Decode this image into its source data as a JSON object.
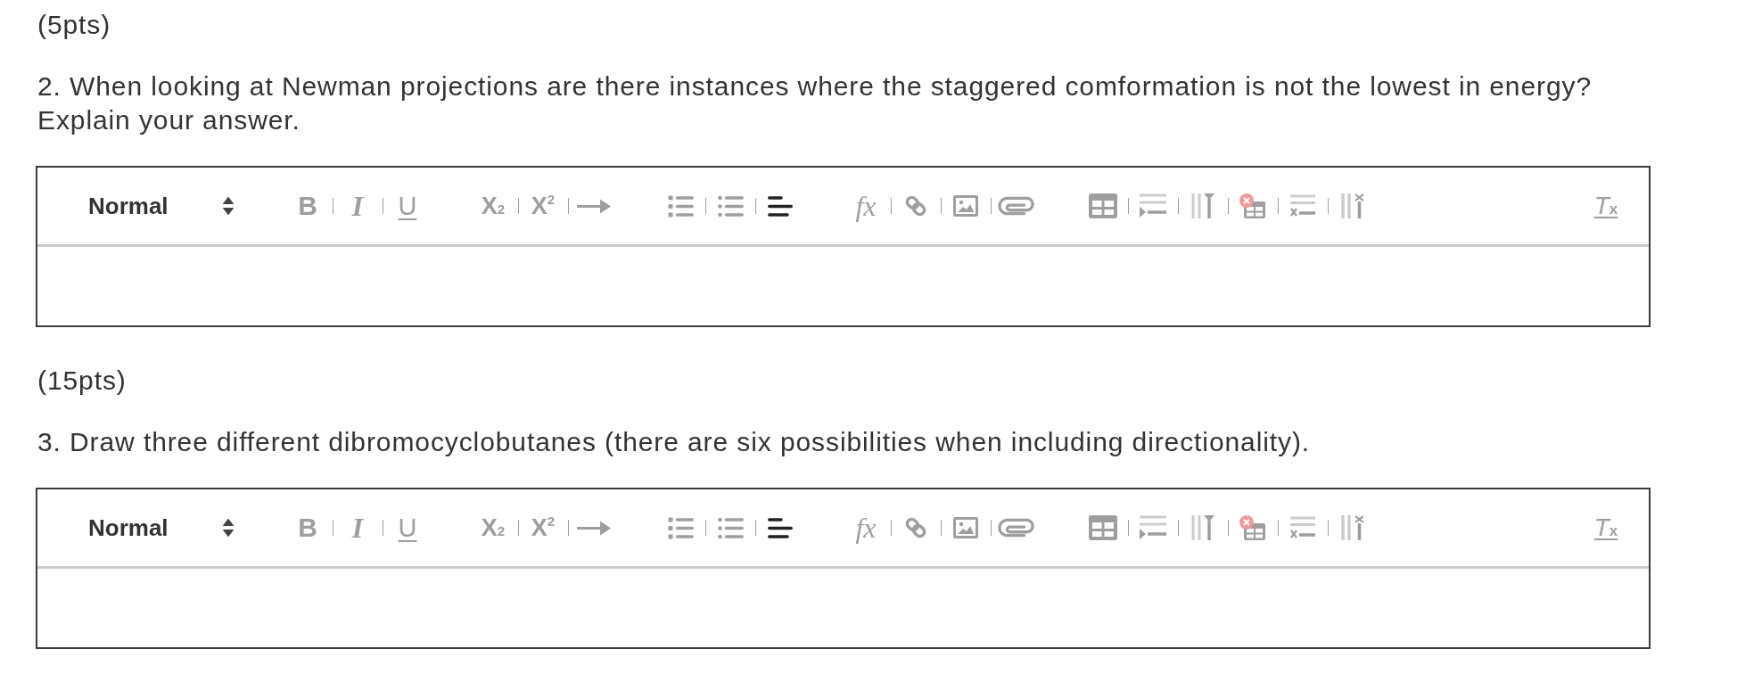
{
  "sections": [
    {
      "points": "(5pts)",
      "question": [
        "2. When looking at Newman projections are there instances where the staggered comformation is not the lowest in energy?",
        "Explain your answer."
      ],
      "editor": {
        "toolbar": {
          "format": "Normal",
          "groups": [
            {
              "buttons": [
                {
                  "kind": "bold",
                  "label": "B",
                  "active": false
                },
                {
                  "kind": "italic",
                  "label": "I",
                  "active": false
                },
                {
                  "kind": "underline",
                  "label": "U",
                  "active": false
                }
              ]
            },
            {
              "buttons": [
                {
                  "kind": "subscript",
                  "label": "X$_{2}$",
                  "active": false
                },
                {
                  "kind": "superscript",
                  "label": "X$^{2}$",
                  "active": false
                },
                {
                  "kind": "arrow",
                  "active": false
                }
              ]
            },
            {
              "buttons": [
                {
                  "kind": "ordered-list",
                  "active": false
                },
                {
                  "kind": "bullet-list",
                  "active": false
                },
                {
                  "kind": "align",
                  "active": true
                }
              ]
            },
            {
              "buttons": [
                {
                  "kind": "formula",
                  "label": "fx",
                  "active": false
                },
                {
                  "kind": "link",
                  "active": false
                },
                {
                  "kind": "image",
                  "active": false
                },
                {
                  "kind": "attachment",
                  "active": false
                }
              ]
            },
            {
              "buttons": [
                {
                  "kind": "table",
                  "active": false
                },
                {
                  "kind": "insert-row",
                  "active": false
                },
                {
                  "kind": "insert-column",
                  "active": false
                },
                {
                  "kind": "delete-table",
                  "active": false
                },
                {
                  "kind": "delete-row",
                  "active": false
                },
                {
                  "kind": "delete-column",
                  "active": false
                }
              ]
            }
          ],
          "end_buttons": [
            {
              "kind": "clean",
              "label": "T$_{x}$",
              "active": false
            }
          ]
        }
      }
    },
    {
      "points": "(15pts)",
      "question": [
        "3. Draw three different dibromocyclobutanes (there are six possibilities when including directionality)."
      ],
      "editor": {
        "toolbar": {
          "format": "Normal",
          "groups": [
            {
              "buttons": [
                {
                  "kind": "bold",
                  "label": "B",
                  "active": false
                },
                {
                  "kind": "italic",
                  "label": "I",
                  "active": false
                },
                {
                  "kind": "underline",
                  "label": "U",
                  "active": false
                }
              ]
            },
            {
              "buttons": [
                {
                  "kind": "subscript",
                  "label": "X$_{2}$",
                  "active": false
                },
                {
                  "kind": "superscript",
                  "label": "X$^{2}$",
                  "active": false
                },
                {
                  "kind": "arrow",
                  "active": false
                }
              ]
            },
            {
              "buttons": [
                {
                  "kind": "ordered-list",
                  "active": false
                },
                {
                  "kind": "bullet-list",
                  "active": false
                },
                {
                  "kind": "align",
                  "active": true
                }
              ]
            },
            {
              "buttons": [
                {
                  "kind": "formula",
                  "label": "fx",
                  "active": false
                },
                {
                  "kind": "link",
                  "active": false
                },
                {
                  "kind": "image",
                  "active": false
                },
                {
                  "kind": "attachment",
                  "active": false
                }
              ]
            },
            {
              "buttons": [
                {
                  "kind": "table",
                  "active": false
                },
                {
                  "kind": "insert-row",
                  "active": false
                },
                {
                  "kind": "insert-column",
                  "active": false
                },
                {
                  "kind": "delete-table",
                  "active": false
                },
                {
                  "kind": "delete-row",
                  "active": false
                },
                {
                  "kind": "delete-column",
                  "active": false
                }
              ]
            }
          ],
          "end_buttons": [
            {
              "kind": "clean",
              "label": "T$_{x}$",
              "active": false
            }
          ]
        }
      }
    }
  ]
}
